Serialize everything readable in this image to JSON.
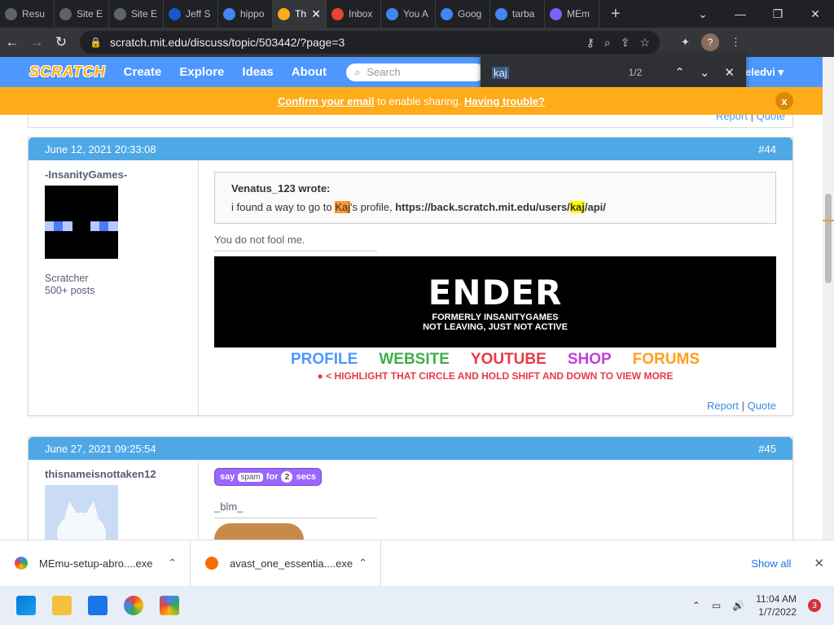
{
  "browser": {
    "tabs": [
      {
        "label": "Resu",
        "icon": "globe-icon"
      },
      {
        "label": "Site E",
        "icon": "globe-icon"
      },
      {
        "label": "Site E",
        "icon": "globe-icon"
      },
      {
        "label": "Jeff S",
        "icon": "j-icon"
      },
      {
        "label": "hippo",
        "icon": "google-icon"
      },
      {
        "label": "Th",
        "icon": "scratch-icon",
        "active": true
      },
      {
        "label": "Inbox",
        "icon": "gmail-icon"
      },
      {
        "label": "You A",
        "icon": "g-icon"
      },
      {
        "label": "Goog",
        "icon": "google-icon"
      },
      {
        "label": "tarba",
        "icon": "google-icon"
      },
      {
        "label": "MEm",
        "icon": "memu-icon"
      }
    ],
    "url": "scratch.mit.edu/discuss/topic/503442/?page=3",
    "profile_initial": "?",
    "find": {
      "term": "kaj",
      "count": "1/2"
    }
  },
  "scratch_nav": {
    "logo": "SCRATCH",
    "links": [
      "Create",
      "Explore",
      "Ideas",
      "About"
    ],
    "search_placeholder": "Search",
    "user": "eledvi"
  },
  "banner": {
    "confirm": "Confirm your email",
    "middle": " to enable sharing. ",
    "trouble": "Having trouble?",
    "close": "x"
  },
  "prev_actions": {
    "report": "Report",
    "sep": " | ",
    "quote": "Quote"
  },
  "posts": [
    {
      "date": "June 12, 2021 20:33:08",
      "number": "#44",
      "username": "-InsanityGames-",
      "rank": "Scratcher",
      "posts": "500+ posts",
      "quote_author": "Venatus_123 wrote:",
      "quote_pre": "i found a way to go to ",
      "quote_hl": "Kaj",
      "quote_mid": "'s profile, ",
      "quote_link_pre": "https://back.scratch.mit.edu/users/",
      "quote_link_hl": "kaj",
      "quote_link_post": "/api/",
      "text": "You do not fool me.",
      "sig": {
        "title": "ENDER",
        "sub1": "FORMERLY INSANITYGAMES",
        "sub2": "NOT LEAVING, JUST NOT ACTIVE",
        "links": [
          {
            "label": "PROFILE",
            "color": "#4d97ff"
          },
          {
            "label": "WEBSITE",
            "color": "#3fae49"
          },
          {
            "label": "YOUTUBE",
            "color": "#e63a49"
          },
          {
            "label": "SHOP",
            "color": "#c33dde"
          },
          {
            "label": "FORUMS",
            "color": "#ff9f1a"
          }
        ],
        "tip": "● < HIGHLIGHT THAT CIRCLE AND HOLD SHIFT AND DOWN TO VIEW MORE"
      },
      "report": "Report",
      "quote": "Quote"
    },
    {
      "date": "June 27, 2021 09:25:54",
      "number": "#45",
      "username": "thisnameisnottaken12",
      "block": {
        "say": "say",
        "word": "spam",
        "for": "for",
        "num": "2",
        "secs": "secs"
      },
      "text": "_blm_"
    }
  ],
  "downloads": [
    {
      "name": "MEmu-setup-abro....exe",
      "icon": "memu-icon"
    },
    {
      "name": "avast_one_essentia....exe",
      "icon": "avast-icon"
    }
  ],
  "downloads_show_all": "Show all",
  "taskbar": {
    "time": "11:04 AM",
    "date": "1/7/2022",
    "notifications": "3"
  }
}
